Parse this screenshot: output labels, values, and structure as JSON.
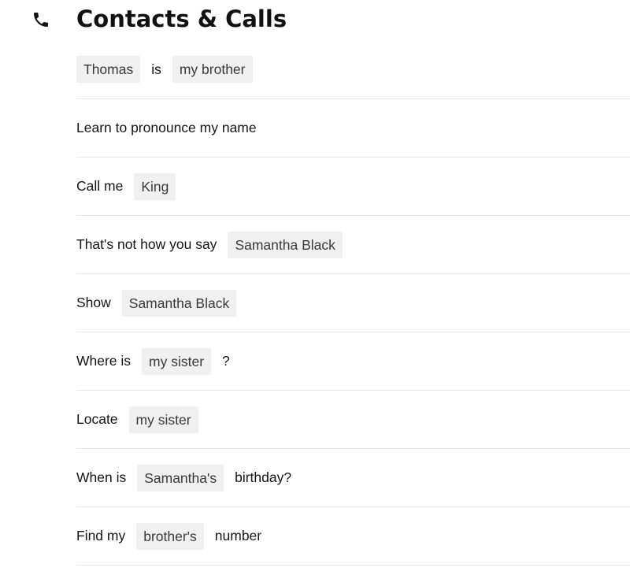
{
  "header": {
    "icon": "phone-icon",
    "title": "Contacts & Calls"
  },
  "commands": [
    {
      "parts": [
        "Thomas",
        "is",
        "my brother"
      ]
    },
    {
      "parts": [
        "Learn to pronounce my name"
      ]
    },
    {
      "parts": [
        "Call me",
        "King"
      ]
    },
    {
      "parts": [
        "That's not how you say",
        "Samantha Black"
      ]
    },
    {
      "parts": [
        "Show",
        "Samantha Black"
      ]
    },
    {
      "parts": [
        "Where is",
        "my sister",
        "?"
      ]
    },
    {
      "parts": [
        "Locate",
        "my sister"
      ]
    },
    {
      "parts": [
        "When is",
        "Samantha's",
        "birthday?"
      ]
    },
    {
      "parts": [
        "Find my",
        "brother's",
        "number"
      ]
    }
  ]
}
